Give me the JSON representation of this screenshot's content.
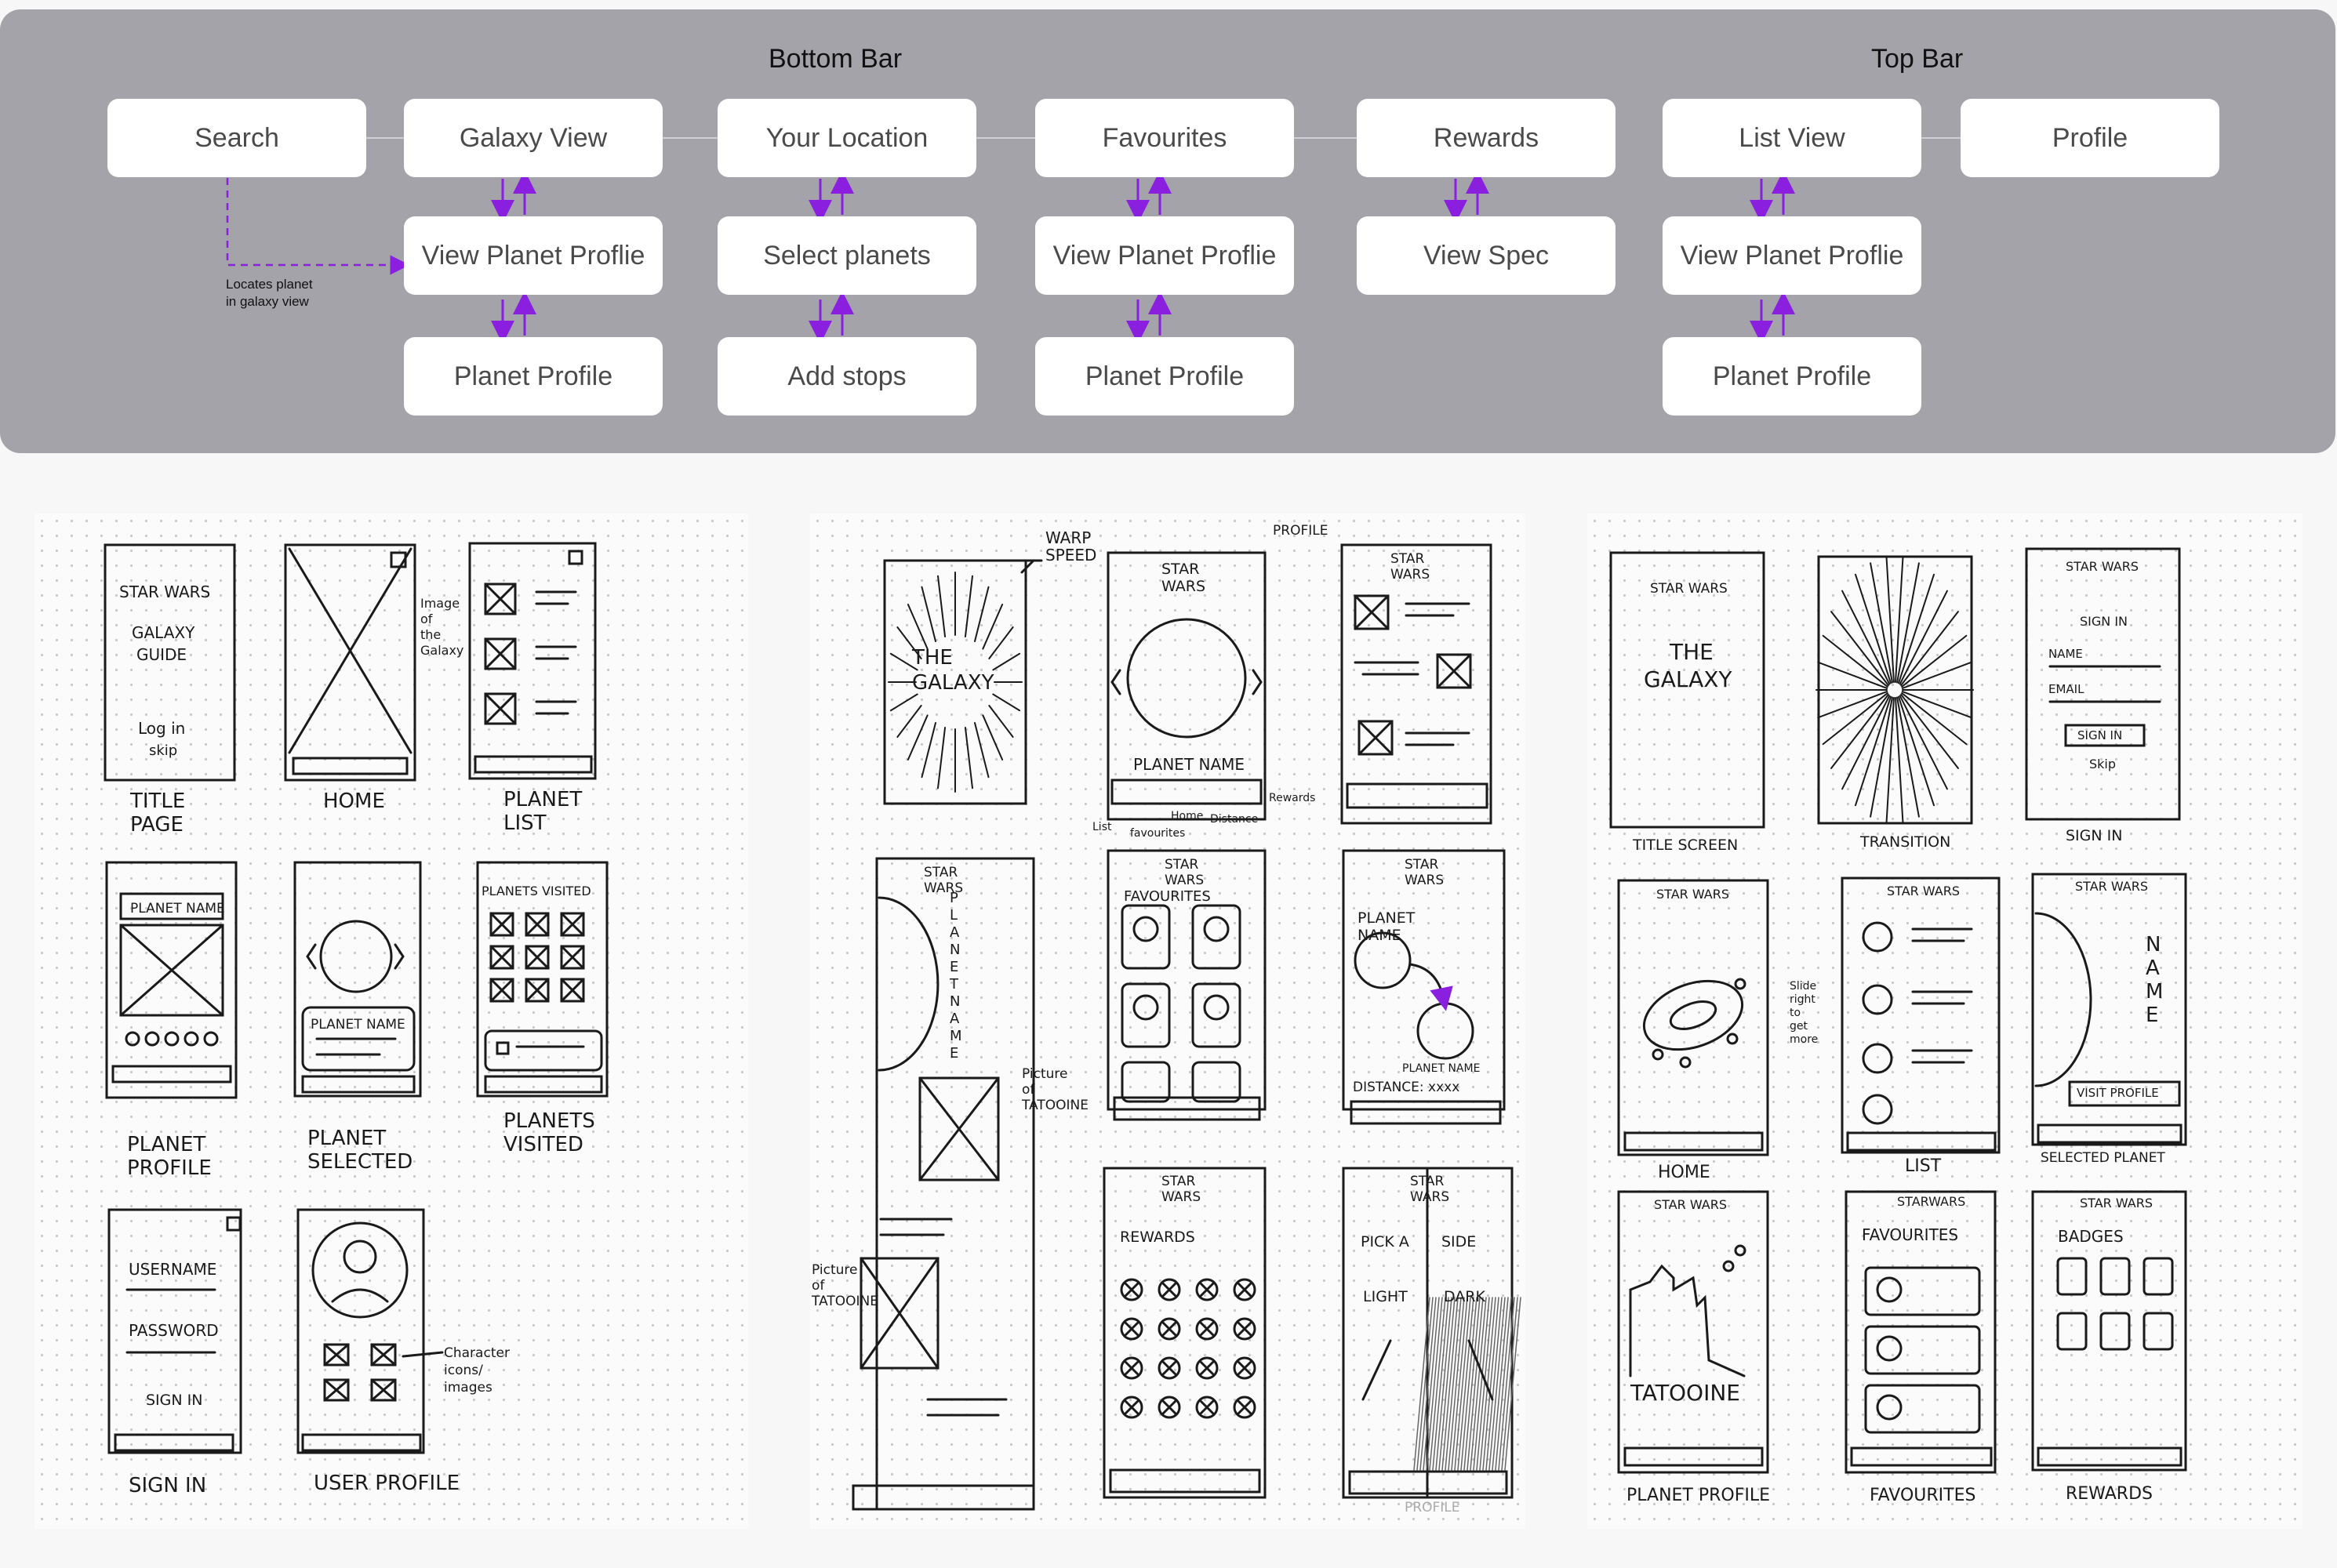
{
  "flow": {
    "sections": [
      {
        "id": "bottom",
        "title": "Bottom Bar"
      },
      {
        "id": "top",
        "title": "Top Bar"
      }
    ],
    "nodes": {
      "search": "Search",
      "galaxy_view": "Galaxy View",
      "your_location": "Your Location",
      "favourites": "Favourites",
      "rewards": "Rewards",
      "list_view": "List View",
      "profile": "Profile",
      "view_planet_profile_1": "View Planet Proflie",
      "select_planets": "Select planets",
      "view_planet_profile_2": "View Planet Proflie",
      "view_spec": "View Spec",
      "view_planet_profile_3": "View Planet Proflie",
      "planet_profile_1": "Planet Profile",
      "add_stops": "Add stops",
      "planet_profile_2": "Planet Profile",
      "planet_profile_3": "Planet Profile"
    },
    "search_note": [
      "Locates planet",
      "in galaxy view"
    ],
    "colors": {
      "panel": "#a3a3a9",
      "arrow": "#8a1fe0",
      "connector": "#cfcfd4",
      "node_text": "#4a4a4a"
    }
  },
  "sketches": {
    "sheet1": {
      "frames": [
        {
          "id": "title",
          "texts": [
            "STAR WARS",
            "GALAXY",
            "GUIDE",
            "Log in",
            "skip"
          ],
          "caption": [
            "TITLE",
            "PAGE"
          ]
        },
        {
          "id": "home",
          "texts": [],
          "caption": [
            "HOME"
          ],
          "note": [
            "Image",
            "of",
            "the",
            "Galaxy"
          ]
        },
        {
          "id": "planet_list",
          "texts": [],
          "caption": [
            "PLANET",
            "LIST"
          ]
        },
        {
          "id": "planet_profile",
          "texts": [
            "PLANET NAME"
          ],
          "caption": [
            "PLANET",
            "PROFILE"
          ]
        },
        {
          "id": "planet_selected",
          "texts": [
            "PLANET NAME"
          ],
          "caption": [
            "PLANET",
            "SELECTED"
          ]
        },
        {
          "id": "planets_visited",
          "texts": [
            "PLANETS VISITED"
          ],
          "caption": [
            "PLANETS",
            "VISITED"
          ]
        },
        {
          "id": "sign_in",
          "texts": [
            "USERNAME",
            "PASSWORD",
            "SIGN IN"
          ],
          "caption": [
            "SIGN IN"
          ]
        },
        {
          "id": "user_profile",
          "texts": [],
          "caption": [
            "USER PROFILE"
          ],
          "note": [
            "Character",
            "icons/",
            "images"
          ]
        }
      ]
    },
    "sheet2": {
      "labels": {
        "warp": [
          "WARP",
          "SPEED"
        ],
        "profile_top": "PROFILE",
        "galaxy": [
          "THE",
          "GALAXY"
        ],
        "star_wars": [
          "STAR",
          "WARS"
        ],
        "planet_name": "PLANET NAME",
        "nav_labels": [
          "List",
          "Home",
          "Distance",
          "Rewards",
          "favourites"
        ],
        "favourites": "FAVOURITES",
        "planet_name2": [
          "PLANET",
          "NAME"
        ],
        "planet_name3": "PLANET NAME",
        "distance": "DISTANCE: xxxx",
        "vertical_name": "PLANET NAME",
        "picture_tatooine": [
          "Picture",
          "of",
          "TATOOINE"
        ],
        "picture_tatooine2": [
          "Picture",
          "of",
          "TATOOINE"
        ],
        "rewards": "REWARDS",
        "pick_side": [
          "PICK A",
          "SIDE"
        ],
        "light": "LIGHT",
        "dark": "DARK",
        "profile_bottom": "PROFILE"
      }
    },
    "sheet3": {
      "labels": {
        "title_texts": [
          "STAR WARS",
          "THE",
          "GALAXY"
        ],
        "title_caption": "TITLE SCREEN",
        "transition": "TRANSITION",
        "signin_texts": [
          "STAR WARS",
          "SIGN IN",
          "NAME",
          "EMAIL",
          "SIGN IN",
          "Skip"
        ],
        "signin_caption": "SIGN IN",
        "home_header": "STAR WARS",
        "home_caption": "HOME",
        "slide_note": [
          "Slide",
          "right",
          "to",
          "get",
          "more"
        ],
        "list_header": "STAR WARS",
        "list_caption": "LIST",
        "selected_header": "STAR WARS",
        "selected_name": "NAME",
        "visit_profile": "VISIT PROFILE",
        "selected_caption": "SELECTED PLANET",
        "pp_header": "STAR WARS",
        "pp_name": "TATOOINE",
        "pp_caption": "PLANET PROFILE",
        "fav_header": "STARWARS",
        "fav_title": "FAVOURITES",
        "fav_caption": "FAVOURITES",
        "rew_header": "STAR WARS",
        "rew_title": "BADGES",
        "rew_caption": "REWARDS"
      }
    }
  }
}
